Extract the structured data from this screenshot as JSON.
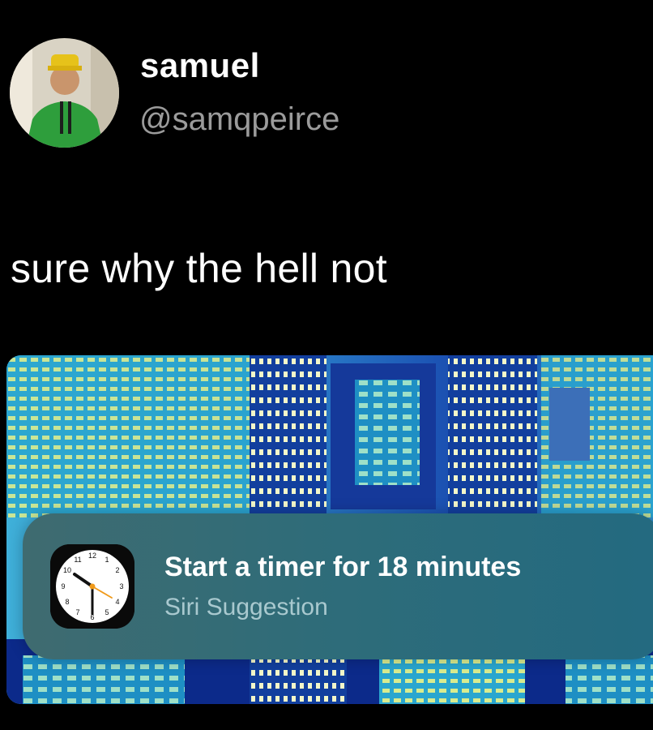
{
  "user": {
    "display_name": "samuel",
    "handle": "@samqpeirce",
    "avatar_icon": "profile-photo"
  },
  "tweet": {
    "text": "sure why the hell not"
  },
  "siri_suggestion": {
    "title": "Start a timer for 18 minutes",
    "subtitle": "Siri Suggestion",
    "app_icon": "clock-icon",
    "clock_numbers": [
      "12",
      "1",
      "2",
      "3",
      "4",
      "5",
      "6",
      "7",
      "8",
      "9",
      "10",
      "11"
    ]
  },
  "colors": {
    "background": "#000000",
    "handle_gray": "#9b9b9b",
    "card_teal": "#2f6c79",
    "wallpaper_blue": "#0c2a8a",
    "wallpaper_cyan": "#3ab5d8",
    "wallpaper_yellow": "#e6ee8a"
  }
}
